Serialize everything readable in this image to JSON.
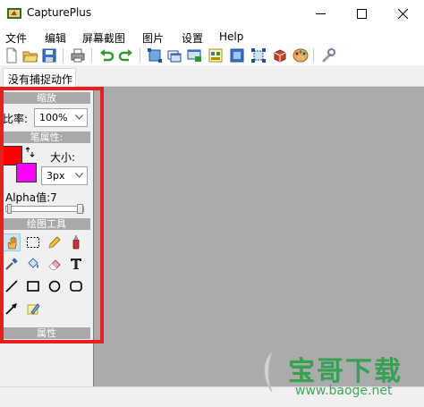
{
  "window": {
    "title": "CapturePlus"
  },
  "menu": {
    "items": [
      {
        "label": "文件"
      },
      {
        "label": "编辑"
      },
      {
        "label": "屏幕截图"
      },
      {
        "label": "图片"
      },
      {
        "label": "设置"
      },
      {
        "label": "Help"
      }
    ]
  },
  "toolbar": {
    "icons": [
      "new-icon",
      "open-icon",
      "save-icon",
      "print-icon",
      "undo-icon",
      "redo-icon",
      "capture-region-icon",
      "capture-window-icon",
      "capture-screen-icon",
      "capture-object-icon",
      "capture-fullscreen-icon",
      "capture-fixed-icon",
      "capture-scroll-icon",
      "palette-icon",
      "wrench-icon"
    ]
  },
  "tabs": [
    {
      "label": "没有捕捉动作"
    }
  ],
  "panel": {
    "zoom_header": "缩放",
    "ratio_label": "比率:",
    "ratio_value": "100%",
    "pen_header": "笔属性:",
    "size_label": "大小:",
    "size_value": "3px",
    "alpha_label": "Alpha值:7",
    "alpha_value": 7,
    "tools_header": "绘图工具",
    "props_header": "属性",
    "primary_color": "#ff0000",
    "secondary_color": "#ff00ff",
    "tools": [
      "hand-icon",
      "rect-select-icon",
      "pencil-icon",
      "spray-icon",
      "eyedropper-icon",
      "fill-bucket-icon",
      "eraser-icon",
      "text-icon",
      "line-icon",
      "rectangle-icon",
      "ellipse-icon",
      "rounded-rect-icon",
      "arrow-icon",
      "highlighter-icon"
    ]
  },
  "colors": {
    "highlight": "#e8201c",
    "canvas": "#ababab",
    "section_header": "#a9a9a9",
    "watermark": "#2aa04a"
  },
  "watermark": {
    "text": "宝哥下载",
    "url": "www.baoge.net"
  }
}
